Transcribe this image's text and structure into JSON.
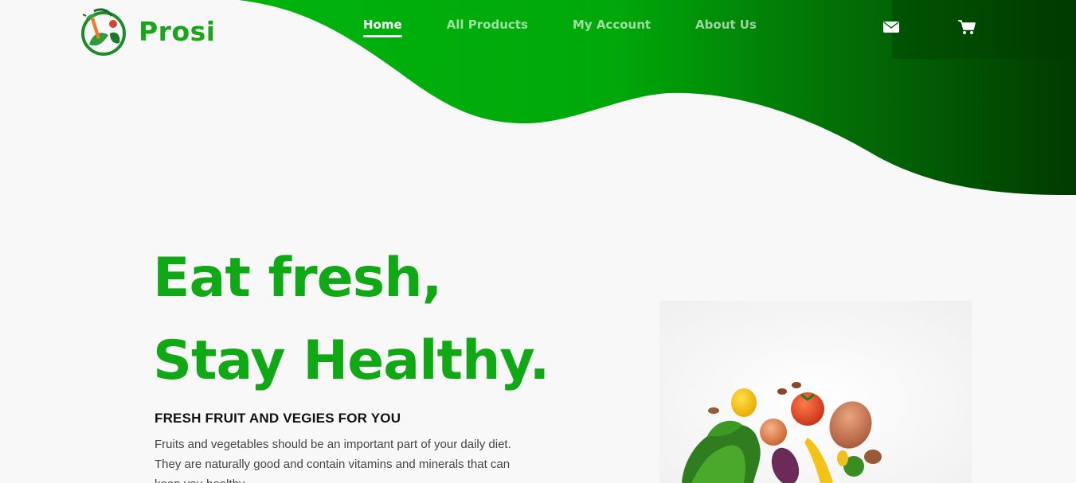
{
  "brand": {
    "name": "Prosi",
    "logo_text": "Prosi",
    "accent_color": "#1aa51a"
  },
  "nav": {
    "items": [
      {
        "label": "Home",
        "active": true
      },
      {
        "label": "All Products",
        "active": false
      },
      {
        "label": "My Account",
        "active": false
      },
      {
        "label": "About Us",
        "active": false
      }
    ],
    "icons": [
      "envelope-icon",
      "cart-icon"
    ]
  },
  "hero": {
    "headline_line1": "Eat fresh,",
    "headline_line2": "Stay Healthy.",
    "subheading": "FRESH FRUIT AND VEGIES FOR YOU",
    "body": "Fruits and vegetables should be an important part of your daily diet. They are naturally good and contain vitamins and minerals that can keep you healthy.",
    "headline_color": "#10a815"
  },
  "colors": {
    "wave_light": "#00aa0a",
    "wave_dark": "#013c00",
    "background": "#f8f8f8"
  }
}
